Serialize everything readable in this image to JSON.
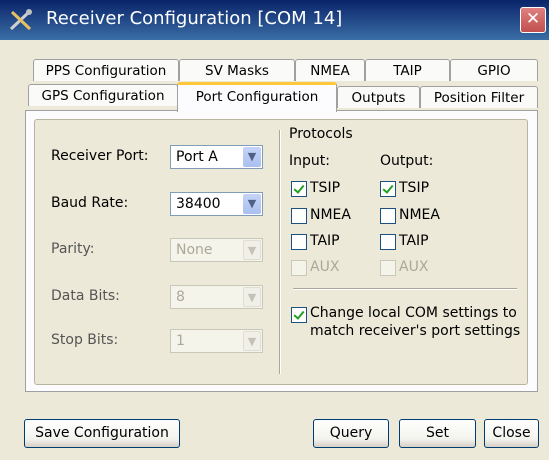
{
  "window": {
    "title": "Receiver Configuration [COM 14]",
    "close_glyph": "✕"
  },
  "tabs": {
    "row1": [
      {
        "label": "PPS Configuration"
      },
      {
        "label": "SV Masks"
      },
      {
        "label": "NMEA"
      },
      {
        "label": "TAIP"
      },
      {
        "label": "GPIO"
      }
    ],
    "row2": [
      {
        "label": "GPS Configuration"
      },
      {
        "label": "Port Configuration",
        "active": true
      },
      {
        "label": "Outputs"
      },
      {
        "label": "Position Filter"
      }
    ]
  },
  "port": {
    "receiver_port": {
      "label": "Receiver Port:",
      "value": "Port A"
    },
    "baud_rate": {
      "label": "Baud Rate:",
      "value": "38400"
    },
    "parity": {
      "label": "Parity:",
      "value": "None"
    },
    "data_bits": {
      "label": "Data Bits:",
      "value": "8"
    },
    "stop_bits": {
      "label": "Stop Bits:",
      "value": "1"
    }
  },
  "protocols": {
    "title": "Protocols",
    "input_label": "Input:",
    "output_label": "Output:",
    "input": [
      {
        "label": "TSIP",
        "checked": true,
        "enabled": true
      },
      {
        "label": "NMEA",
        "checked": false,
        "enabled": true
      },
      {
        "label": "TAIP",
        "checked": false,
        "enabled": true
      },
      {
        "label": "AUX",
        "checked": false,
        "enabled": false
      }
    ],
    "output": [
      {
        "label": "TSIP",
        "checked": true,
        "enabled": true
      },
      {
        "label": "NMEA",
        "checked": false,
        "enabled": true
      },
      {
        "label": "TAIP",
        "checked": false,
        "enabled": true
      },
      {
        "label": "AUX",
        "checked": false,
        "enabled": false
      }
    ],
    "change_local": {
      "line1": "Change local COM settings to",
      "line2": "match receiver's port settings",
      "checked": true
    }
  },
  "buttons": {
    "save": "Save Configuration",
    "query": "Query",
    "set": "Set",
    "close": "Close"
  },
  "icons": {
    "title": "tools-icon",
    "dropdown": "chevron-down-icon"
  }
}
